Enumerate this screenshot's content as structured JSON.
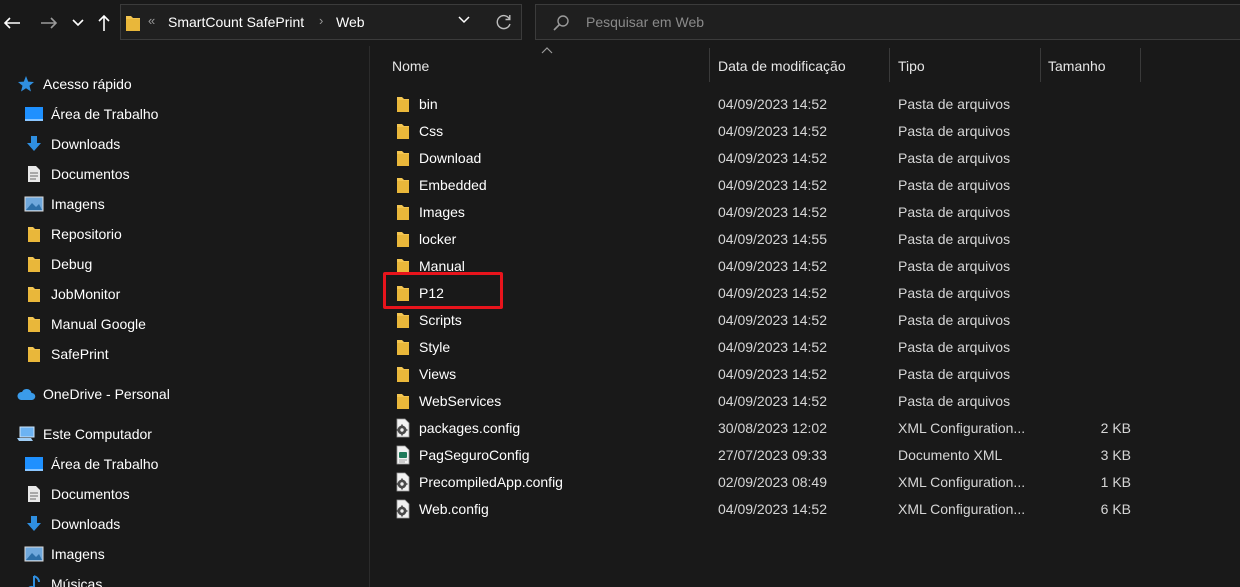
{
  "toolbar": {
    "back_icon": "arrow-left-icon",
    "forward_icon": "arrow-right-icon",
    "recent_icon": "chevron-down-icon",
    "up_icon": "arrow-up-icon"
  },
  "address": {
    "crumbs": [
      "SmartCount SafePrint",
      "Web"
    ],
    "overflow_marker": "«"
  },
  "search": {
    "placeholder": "Pesquisar em Web"
  },
  "sidebar": {
    "items": [
      {
        "label": "Acesso rápido",
        "icon": "star-icon",
        "level": 0,
        "pinned": false
      },
      {
        "label": "Área de Trabalho",
        "icon": "desktop-icon",
        "level": 1,
        "pinned": true
      },
      {
        "label": "Downloads",
        "icon": "download-icon",
        "level": 1,
        "pinned": true
      },
      {
        "label": "Documentos",
        "icon": "document-icon",
        "level": 1,
        "pinned": true
      },
      {
        "label": "Imagens",
        "icon": "image-icon",
        "level": 1,
        "pinned": true
      },
      {
        "label": "Repositorio",
        "icon": "folder-icon",
        "level": 1,
        "pinned": true
      },
      {
        "label": "Debug",
        "icon": "folder-icon",
        "level": 1,
        "pinned": false
      },
      {
        "label": "JobMonitor",
        "icon": "folder-icon",
        "level": 1,
        "pinned": false
      },
      {
        "label": "Manual Google",
        "icon": "folder-icon",
        "level": 1,
        "pinned": false
      },
      {
        "label": "SafePrint",
        "icon": "folder-icon",
        "level": 1,
        "pinned": false
      },
      {
        "label": "OneDrive - Personal",
        "icon": "cloud-icon",
        "level": 0,
        "pinned": false
      },
      {
        "label": "Este Computador",
        "icon": "computer-icon",
        "level": 0,
        "pinned": false
      },
      {
        "label": "Área de Trabalho",
        "icon": "desktop-icon",
        "level": 1,
        "pinned": false
      },
      {
        "label": "Documentos",
        "icon": "document-icon",
        "level": 1,
        "pinned": false
      },
      {
        "label": "Downloads",
        "icon": "download-icon",
        "level": 1,
        "pinned": false
      },
      {
        "label": "Imagens",
        "icon": "image-icon",
        "level": 1,
        "pinned": false
      },
      {
        "label": "Músicas",
        "icon": "music-icon",
        "level": 1,
        "pinned": false
      }
    ]
  },
  "columns": {
    "name": "Nome",
    "date": "Data de modificação",
    "type": "Tipo",
    "size": "Tamanho"
  },
  "files": [
    {
      "name": "bin",
      "date": "04/09/2023 14:52",
      "type": "Pasta de arquivos",
      "size": "",
      "icon": "folder-icon"
    },
    {
      "name": "Css",
      "date": "04/09/2023 14:52",
      "type": "Pasta de arquivos",
      "size": "",
      "icon": "folder-icon"
    },
    {
      "name": "Download",
      "date": "04/09/2023 14:52",
      "type": "Pasta de arquivos",
      "size": "",
      "icon": "folder-icon"
    },
    {
      "name": "Embedded",
      "date": "04/09/2023 14:52",
      "type": "Pasta de arquivos",
      "size": "",
      "icon": "folder-icon"
    },
    {
      "name": "Images",
      "date": "04/09/2023 14:52",
      "type": "Pasta de arquivos",
      "size": "",
      "icon": "folder-icon"
    },
    {
      "name": "locker",
      "date": "04/09/2023 14:55",
      "type": "Pasta de arquivos",
      "size": "",
      "icon": "folder-icon"
    },
    {
      "name": "Manual",
      "date": "04/09/2023 14:52",
      "type": "Pasta de arquivos",
      "size": "",
      "icon": "folder-icon"
    },
    {
      "name": "P12",
      "date": "04/09/2023 14:52",
      "type": "Pasta de arquivos",
      "size": "",
      "icon": "folder-icon"
    },
    {
      "name": "Scripts",
      "date": "04/09/2023 14:52",
      "type": "Pasta de arquivos",
      "size": "",
      "icon": "folder-icon"
    },
    {
      "name": "Style",
      "date": "04/09/2023 14:52",
      "type": "Pasta de arquivos",
      "size": "",
      "icon": "folder-icon"
    },
    {
      "name": "Views",
      "date": "04/09/2023 14:52",
      "type": "Pasta de arquivos",
      "size": "",
      "icon": "folder-icon"
    },
    {
      "name": "WebServices",
      "date": "04/09/2023 14:52",
      "type": "Pasta de arquivos",
      "size": "",
      "icon": "folder-icon"
    },
    {
      "name": "packages.config",
      "date": "30/08/2023 12:02",
      "type": "XML Configuration...",
      "size": "2 KB",
      "icon": "config-file-icon"
    },
    {
      "name": "PagSeguroConfig",
      "date": "27/07/2023 09:33",
      "type": "Documento XML",
      "size": "3 KB",
      "icon": "xml-document-icon"
    },
    {
      "name": "PrecompiledApp.config",
      "date": "02/09/2023 08:49",
      "type": "XML Configuration...",
      "size": "1 KB",
      "icon": "config-file-icon"
    },
    {
      "name": "Web.config",
      "date": "04/09/2023 14:52",
      "type": "XML Configuration...",
      "size": "6 KB",
      "icon": "config-file-icon"
    }
  ],
  "annotation": {
    "highlighted_item": "P12",
    "color": "#e8141c"
  },
  "colors": {
    "background": "#191919",
    "folder": "#f3c550",
    "accent": "#2f8fe0"
  }
}
